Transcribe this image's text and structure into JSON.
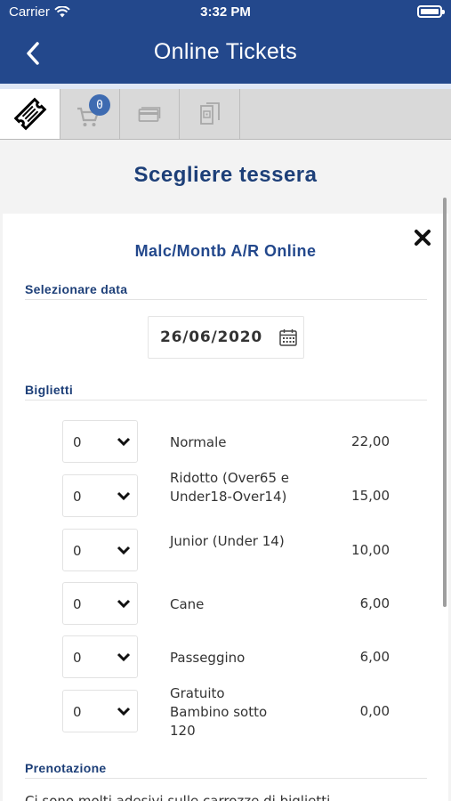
{
  "status_bar": {
    "carrier": "Carrier",
    "time": "3:32 PM"
  },
  "nav": {
    "title": "Online Tickets"
  },
  "tabs": [
    {
      "icon": "ticket-icon",
      "active": true
    },
    {
      "icon": "cart-icon",
      "badge": "0"
    },
    {
      "icon": "credit-card-icon"
    },
    {
      "icon": "receipt-icon"
    }
  ],
  "page": {
    "title": "Scegliere tessera"
  },
  "card": {
    "title": "Malc/Montb A/R Online",
    "date_section_label": "Selezionare data",
    "date_value": "26/06/2020",
    "tickets_section_label": "Biglietti",
    "tickets": [
      {
        "qty": "0",
        "name": "Normale",
        "price": "22,00"
      },
      {
        "qty": "0",
        "name": "Ridotto (Over65 e Under18-Over14)",
        "price": "15,00"
      },
      {
        "qty": "0",
        "name": "Junior (Under 14)",
        "price": "10,00"
      },
      {
        "qty": "0",
        "name": "Cane",
        "price": "6,00"
      },
      {
        "qty": "0",
        "name": "Passeggino",
        "price": "6,00"
      },
      {
        "qty": "0",
        "name": "Gratuito Bambino sotto 120",
        "price": "0,00"
      }
    ],
    "booking_section_label": "Prenotazione",
    "booking_text": "Ci sono molti adesivi sulle carrozze di biglietti"
  }
}
